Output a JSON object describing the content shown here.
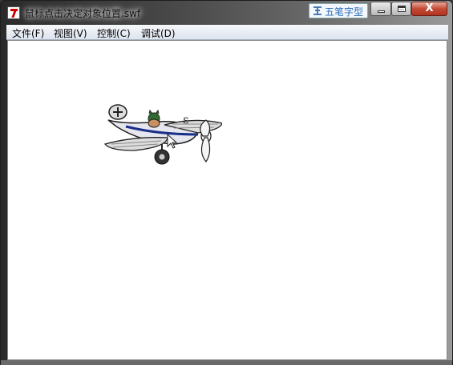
{
  "window": {
    "title": "鼠标点击决定对象位置.swf",
    "ime_label": "五笔字型",
    "close_glyph": "X"
  },
  "menu": {
    "items": [
      "文件(F)",
      "视图(V)",
      "控制(C)",
      "调试(D)"
    ]
  },
  "stage": {
    "plane_letter": "ε"
  }
}
